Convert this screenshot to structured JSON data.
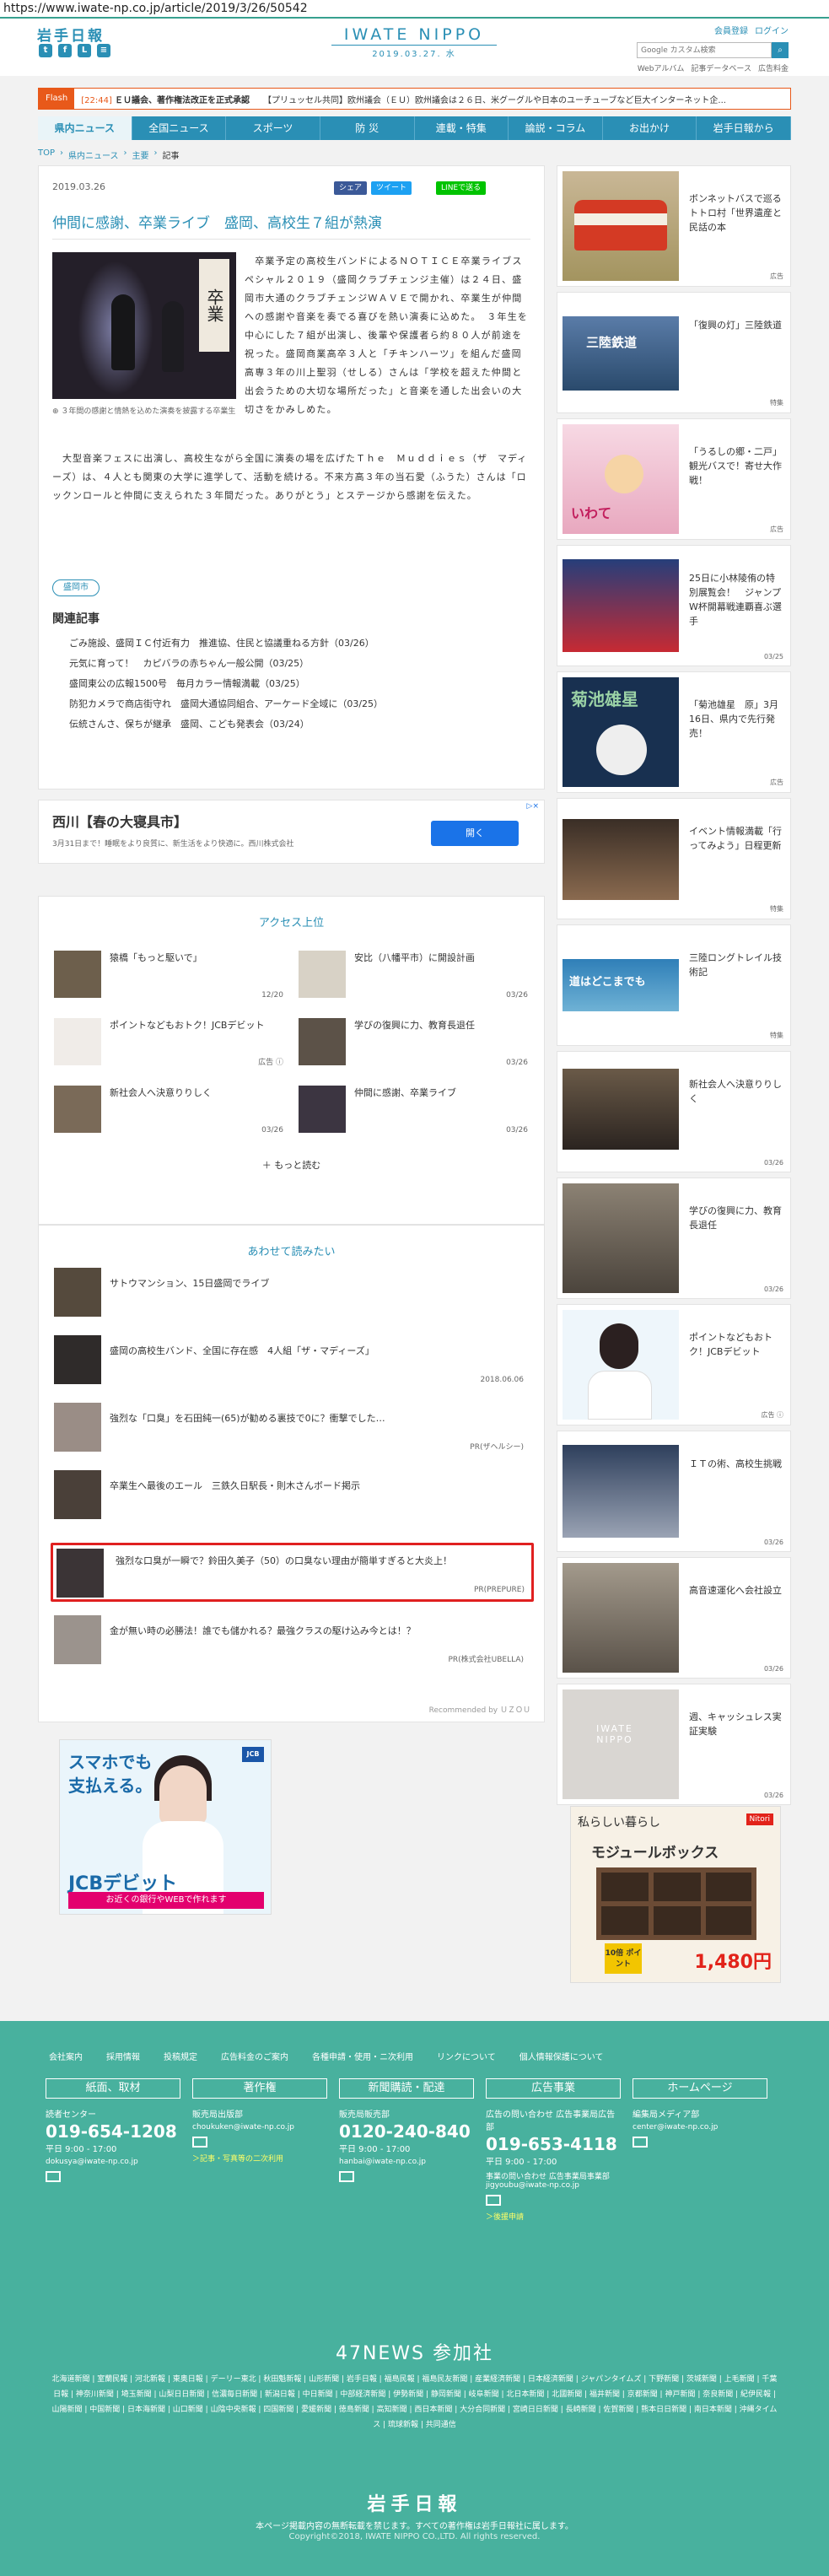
{
  "url": "https://www.iwate-np.co.jp/article/2019/3/26/50542",
  "header": {
    "logo": "岩手日報",
    "brand": "IWATE NIPPO",
    "date": "2019.03.27. 水",
    "register": "会員登録",
    "login": "ログイン",
    "search_placeholder": "Google カスタム検索",
    "subnav": [
      "Webアルバム",
      "記事データベース",
      "広告料金"
    ]
  },
  "flash": {
    "tag": "Flash",
    "items": [
      {
        "time": "[22:44]",
        "text": "ＥＵ議会、著作権法改正を正式承認"
      },
      {
        "time": "",
        "text": "【プリュッセル共同】欧州議会（ＥＵ）欧州議会は２６日、米グーグルや日本のユーチューブなど巨大インターネット企..."
      }
    ]
  },
  "nav": [
    "県内ニュース",
    "全国ニュース",
    "スポーツ",
    "防 災",
    "連載・特集",
    "論説・コラム",
    "お出かけ",
    "岩手日報から"
  ],
  "breadcrumb": [
    "TOP",
    "県内ニュース",
    "主要",
    "記事"
  ],
  "article": {
    "date": "2019.03.26",
    "share_fb": "シェア",
    "share_tw": "ツイート",
    "share_line": "LINEで送る",
    "title": "仲間に感謝、卒業ライブ　盛岡、高校生７組が熱演",
    "caption": "３年間の感謝と情熱を込めた演奏を披露する卒業生",
    "lead": "　卒業予定の高校生バンドによるＮＯＴＩＣＥ卒業ライブスペシャル２０１９（盛岡クラブチェンジ主催）は２４日、盛岡市大通のクラブチェンジＷＡＶＥで開かれ、卒業生が仲間への感謝や音楽を奏でる喜びを熱い演奏に込めた。　３年生を中心にした７組が出演し、後輩や保護者ら約８０人が前途を祝った。盛岡商業高卒３人と「チキンハーツ」を組んだ盛岡高専３年の川上聖羽（せしる）さんは「学校を超えた仲間と出会うための大切な場所だった」と音楽を通した出会いの大切さをかみしめた。",
    "body": "　大型音楽フェスに出演し、高校生ながら全国に演奏の場を広げたＴｈｅ　Ｍｕｄｄｉｅｓ（ザ　マディーズ）は、４人とも関東の大学に進学して、活動を続ける。不来方高３年の当石愛（ふうた）さんは「ロックンロールと仲間に支えられた３年間だった。ありがとう」とステージから感謝を伝えた。",
    "tag": "盛岡市",
    "related_title": "関連記事",
    "related": [
      "ごみ施設、盛岡ＩＣ付近有力　推進協、住民と協議重ねる方針（03/26）",
      "元気に育って！　カピバラの赤ちゃん一般公開（03/25）",
      "盛岡東公の広報1500号　毎月カラー情報満載（03/25）",
      "防犯カメラで商店街守れ　盛岡大通協同組合、アーケード全域に（03/25）",
      "伝統さんさ、保ちが継承　盛岡、こども発表会（03/24）"
    ]
  },
  "ad": {
    "title": "西川【春の大寝具市】",
    "sub": "3月31日まで！睡眠をより良質に、新生活をより快適に。西川株式会社",
    "button": "開く"
  },
  "ranking": {
    "title": "アクセス上位",
    "items": [
      {
        "t": "猿橋「もっと駆いで」",
        "d": "12/20"
      },
      {
        "t": "安比（八幡平市）に開設計画",
        "d": "03/26"
      },
      {
        "t": "ポイントなどもおトク！JCBデビット",
        "d": "広告 ⓘ"
      },
      {
        "t": "学びの復興に力、教育長退任",
        "d": "03/26"
      },
      {
        "t": "新社会人へ決意りりしく",
        "d": "03/26"
      },
      {
        "t": "仲間に感謝、卒業ライブ",
        "d": "03/26"
      }
    ],
    "more": "＋ もっと読む"
  },
  "recommend": {
    "title": "あわせて読みたい",
    "items": [
      {
        "t": "サトウマンション、15日盛岡でライブ",
        "p": ""
      },
      {
        "t": "盛岡の高校生バンド、全国に存在感　4人組「ザ・マディーズ」",
        "p": "2018.06.06"
      },
      {
        "t": "強烈な「口臭」を石田純一(65)が勧める裏技で0に？衝撃でした…",
        "p": "PR(ザヘルシー)"
      },
      {
        "t": "卒業生へ最後のエール　三鉄久日駅長・則木さんボード掲示",
        "p": ""
      },
      {
        "t": "強烈な口臭が一瞬で？鈴田久美子（50）の口臭ない理由が簡単すぎると大炎上！",
        "p": "PR(PREPURE)"
      },
      {
        "t": "金が無い時の必勝法！誰でも儲かれる？最強クラスの駆け込み今とは！？",
        "p": "PR(株式会社UBELLA)"
      }
    ],
    "uzou": "Recommended by ＵＺＯＵ"
  },
  "jcb": {
    "l1": "スマホでも\n支払える。",
    "l2": "JCBデビット",
    "l3": "お近くの銀行やWEBで作れます",
    "mark": "JCB"
  },
  "side": [
    {
      "t": "ボンネットバスで巡るトトロ村「世界遺産と民話の本",
      "d": "広告"
    },
    {
      "t": "「復興の灯」三陸鉄道",
      "d": "特集"
    },
    {
      "t": "「うるしの郷・二戸」観光バスで！寄せ大作戦！",
      "d": "広告"
    },
    {
      "t": "25日に小林陵侑の特別展覧会！　ジャンプW杯開幕戦連覇喜ぶ選手",
      "d": "03/25"
    },
    {
      "t": "「菊池雄星　原」3月16日、県内で先行発売！",
      "d": "広告"
    },
    {
      "t": "イベント情報満載「行ってみよう」日程更新",
      "d": "特集"
    },
    {
      "t": "三陸ロングトレイル技術記",
      "d": "特集"
    },
    {
      "t": "新社会人へ決意りりしく",
      "d": "03/26"
    },
    {
      "t": "学びの復興に力、教育長退任",
      "d": "03/26"
    },
    {
      "t": "ポイントなどもおトク！JCBデビット",
      "d": "広告 ⓘ"
    },
    {
      "t": "ＩＴの術、高校生挑戦",
      "d": "03/26"
    },
    {
      "t": "高音速運化へ会社設立",
      "d": "03/26"
    },
    {
      "t": "週、キャッシュレス実証実験",
      "d": "03/26"
    }
  ],
  "nitori": {
    "h": "私らしい暮らし",
    "h2": "モジュールボックス",
    "price": "1,480円",
    "pts": "10倍 ポイント",
    "logo": "Nitori"
  },
  "footer": {
    "links": [
      "会社案内",
      "採用情報",
      "投稿規定",
      "広告料金のご案内",
      "各種申請・使用・ニ次利用",
      "リンクについて",
      "個人情報保護について"
    ],
    "cols": [
      {
        "hd": "紙面、取材",
        "lb": "読者センター",
        "ph": "019-654-1208",
        "hr": "平日 9:00 - 17:00",
        "em": "dokusya@iwate-np.co.jp",
        "yl": ""
      },
      {
        "hd": "著作権",
        "lb": "販売局出版部",
        "ph": "",
        "hr": "",
        "em": "choukuken@iwate-np.co.jp",
        "yl": "＞記事・写真等の二次利用"
      },
      {
        "hd": "新聞購読・配達",
        "lb": "販売局販売部",
        "ph": "0120-240-840",
        "hr": "平日 9:00 - 17:00",
        "em": "hanbai@iwate-np.co.jp",
        "yl": ""
      },
      {
        "hd": "広告事業",
        "lb": "広告の問い合わせ 広告事業局広告部",
        "ph": "019-653-4118",
        "hr": "平日 9:00 - 17:00",
        "em": "事業の問い合わせ 広告事業局事業部 jigyoubu@iwate-np.co.jp",
        "yl": "＞後援申請"
      },
      {
        "hd": "ホームページ",
        "lb": "編集局メディア部",
        "ph": "",
        "hr": "",
        "em": "center@iwate-np.co.jp",
        "yl": ""
      }
    ],
    "news47": "47NEWS 参加社",
    "papers": "北海道新聞 | 室蘭民報 | 河北新報 | 東奥日報 | デーリー東北 | 秋田魁新報 | 山形新聞 | 岩手日報 | 福島民報 | 福島民友新聞 | 産業経済新聞 | 日本経済新聞 | ジャパンタイムズ | 下野新聞 | 茨城新聞 | 上毛新聞 | 千葉日報 | 神奈川新聞 | 埼玉新聞 | 山梨日日新聞 | 信濃毎日新聞 | 新潟日報 | 中日新聞 | 中部経済新聞 | 伊勢新聞 | 静岡新聞 | 岐阜新聞 | 北日本新聞 | 北國新聞 | 福井新聞 | 京都新聞 | 神戸新聞 | 奈良新聞 | 紀伊民報 | 山陽新聞 | 中国新聞 | 日本海新聞 | 山口新聞 | 山陰中央新報 | 四国新聞 | 愛媛新聞 | 徳島新聞 | 高知新聞 | 西日本新聞 | 大分合同新聞 | 宮崎日日新聞 | 長崎新聞 | 佐賀新聞 | 熊本日日新聞 | 南日本新聞 | 沖縄タイムス | 琉球新報 | 共同通信",
    "logo": "岩手日報",
    "note": "本ページ掲載内容の無断転載を禁じます。すべての著作権は岩手日報社に属します。",
    "copy": "Copyright©2018, IWATE NIPPO CO.,LTD. All rights reserved."
  }
}
